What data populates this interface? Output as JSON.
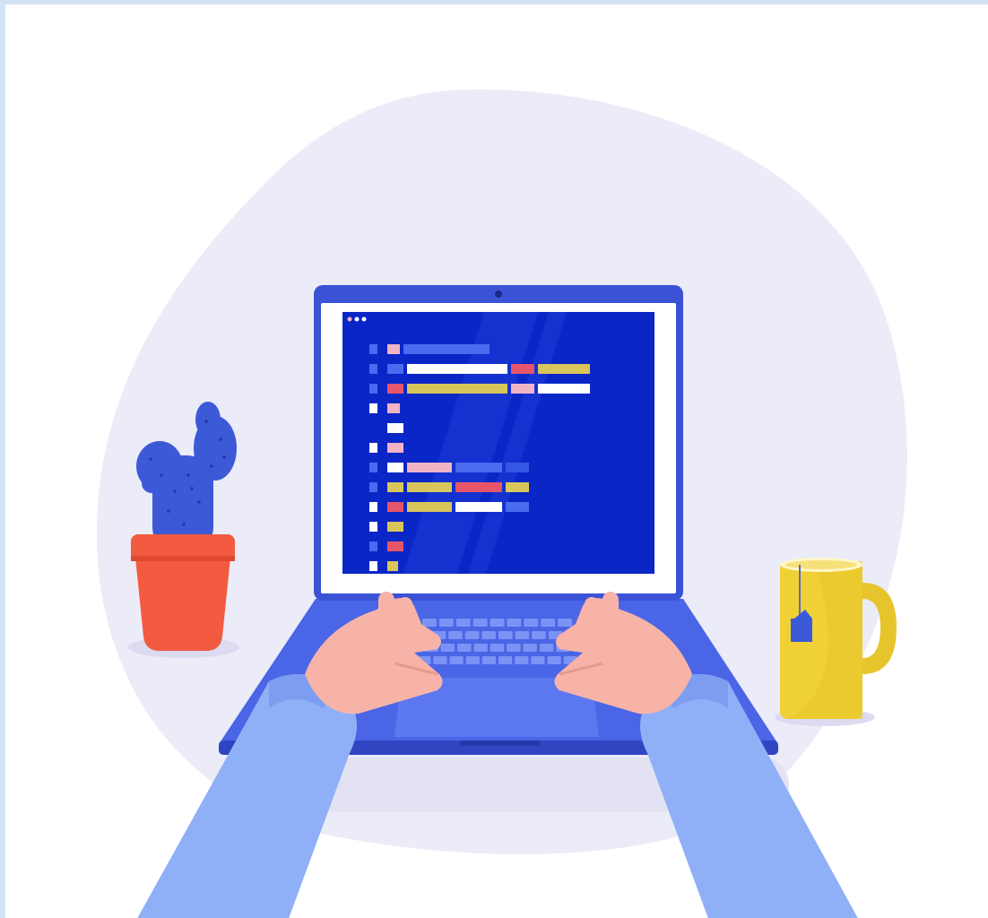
{
  "illustration": {
    "subject": "",
    "colors": {
      "backdrop_blob": "#ecebf8",
      "laptop_body": "#3a53d6",
      "laptop_deck": "#4a66e6",
      "screen_bg": "#0a26c7",
      "screen_bezel": "#ffffff",
      "code_white": "#ffffff",
      "code_pink": "#f0b4c6",
      "code_red": "#e5566a",
      "code_yellow": "#d8c65a",
      "code_blue": "#4a6af0",
      "code_blue_dim": "#3457e4",
      "cactus": "#3c5ad8",
      "pot": "#f25b3f",
      "mug": "#efd136",
      "tea_tag": "#3c5ad8",
      "skin": "#f7b3a7",
      "sleeve": "#8fb0f7"
    },
    "code_lines": [
      {
        "gutter": "blue",
        "tokens": [
          {
            "c": "pink",
            "w": 14
          },
          {
            "c": "blue",
            "w": 96
          }
        ]
      },
      {
        "gutter": "blue",
        "tokens": [
          {
            "c": "blue",
            "w": 18
          },
          {
            "c": "white",
            "w": 112
          },
          {
            "c": "red",
            "w": 26
          },
          {
            "c": "yellow",
            "w": 58
          }
        ]
      },
      {
        "gutter": "blue",
        "tokens": [
          {
            "c": "red",
            "w": 18
          },
          {
            "c": "yellow",
            "w": 112
          },
          {
            "c": "pink",
            "w": 26
          },
          {
            "c": "white",
            "w": 58
          }
        ]
      },
      {
        "gutter": "white",
        "tokens": [
          {
            "c": "pink",
            "w": 14
          }
        ]
      },
      {
        "gutter": "none",
        "tokens": [
          {
            "c": "white",
            "w": 18
          }
        ]
      },
      {
        "gutter": "white",
        "tokens": [
          {
            "c": "pink",
            "w": 18
          }
        ]
      },
      {
        "gutter": "blue",
        "tokens": [
          {
            "c": "white",
            "w": 18
          },
          {
            "c": "pink",
            "w": 50
          },
          {
            "c": "blue",
            "w": 52
          },
          {
            "c": "blue_dim",
            "w": 26
          }
        ]
      },
      {
        "gutter": "blue",
        "tokens": [
          {
            "c": "yellow",
            "w": 18
          },
          {
            "c": "yellow",
            "w": 50
          },
          {
            "c": "red",
            "w": 52
          },
          {
            "c": "yellow",
            "w": 26
          }
        ]
      },
      {
        "gutter": "white",
        "tokens": [
          {
            "c": "red",
            "w": 18
          },
          {
            "c": "yellow",
            "w": 50
          },
          {
            "c": "white",
            "w": 52
          },
          {
            "c": "blue",
            "w": 26
          }
        ]
      },
      {
        "gutter": "white",
        "tokens": [
          {
            "c": "yellow",
            "w": 18
          }
        ]
      },
      {
        "gutter": "blue",
        "tokens": [
          {
            "c": "red",
            "w": 18
          }
        ]
      },
      {
        "gutter": "white",
        "tokens": [
          {
            "c": "yellow",
            "w": 12
          }
        ]
      }
    ]
  }
}
